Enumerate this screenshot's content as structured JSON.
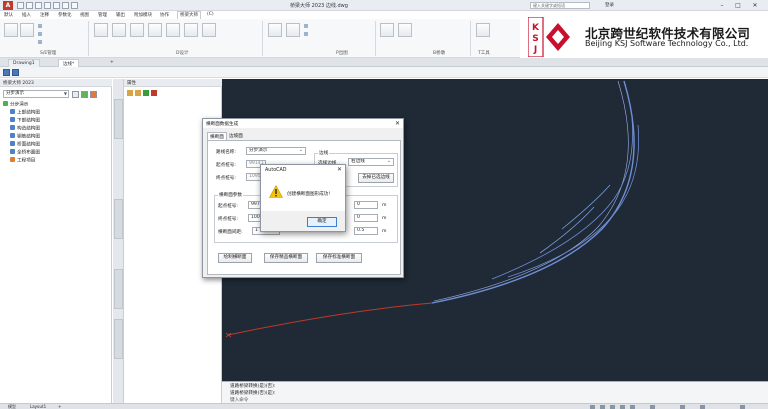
{
  "titlebar": {
    "app_icon": "A",
    "title": "桥梁大师 2023   边线.dwg",
    "search_placeholder": "键入关键字或短语",
    "login": "登录",
    "window_controls": [
      "–",
      "□",
      "✕"
    ]
  },
  "ribbon": {
    "tabs": [
      "默认",
      "插入",
      "注释",
      "参数化",
      "视图",
      "管理",
      "输出",
      "附加模块",
      "协作",
      "桥梁大师",
      "(C)"
    ],
    "active_tab": "桥梁大师",
    "groups": [
      "S/E管理",
      "D设计",
      "P出图",
      "B桥墩",
      "T工具",
      "H帮助"
    ]
  },
  "logo": {
    "cn": "北京跨世纪软件技术有限公司",
    "en": "Beijing KSJ Software Technology Co., Ltd.",
    "mark_text": "KSJ",
    "brand_color": "#c8102e"
  },
  "filetabs": [
    "Drawing1",
    "边线*",
    "+"
  ],
  "left_panel": {
    "title": "桥梁大师 2023",
    "combo_value": "分步演示",
    "tree": [
      {
        "label": "分步演示",
        "level": 0,
        "icon": "project-icon"
      },
      {
        "label": "上部结构图",
        "level": 1,
        "icon": "folder-icon"
      },
      {
        "label": "下部结构图",
        "level": 1,
        "icon": "folder-icon"
      },
      {
        "label": "构造结构图",
        "level": 1,
        "icon": "folder-icon"
      },
      {
        "label": "钢筋结构图",
        "level": 1,
        "icon": "folder-icon"
      },
      {
        "label": "桥面结构图",
        "level": 1,
        "icon": "folder-icon"
      },
      {
        "label": "全桥布置图",
        "level": 1,
        "icon": "folder-icon"
      },
      {
        "label": "工程项目",
        "level": 1,
        "icon": "folder-icon"
      }
    ]
  },
  "prop_panel": {
    "title": "属性"
  },
  "command_line": {
    "lines": [
      "道路桥梁转换(是)(否):",
      "道路桥梁转换(否)(是):"
    ],
    "input_placeholder": "键入命令"
  },
  "statusbar": {
    "tabs": [
      "模型",
      "Layout1",
      "+"
    ]
  },
  "dialog": {
    "title": "横断面数据生成",
    "tabs": [
      "横断面",
      "边坡面"
    ],
    "active_tab": "横断面",
    "road_name_label": "路线名称:",
    "road_name_value": "分步演示",
    "start_label": "起点桩号:",
    "start_value": "99141",
    "end_label": "终点桩号:",
    "end_value": "1095",
    "edge_group": "边线",
    "edge_sub_label": "选择边线",
    "edge_combo": "右边线",
    "edge_button": "去掉已选边线",
    "section_group": "横断面参数",
    "sec_start_label": "起点桩号:",
    "sec_start_value": "99731",
    "sec_end_label": "终点桩号:",
    "sec_end_value": "100563",
    "sec_step_label": "横断面间距:",
    "sec_step_value": "1",
    "right_val_1": "0",
    "right_val_2": "0",
    "right_val_3": "0.5",
    "unit": "m",
    "buttons": [
      "绘制横断面",
      "保存精品横断面",
      "保存标准横断面"
    ]
  },
  "msgbox": {
    "title": "AutoCAD",
    "message": "创建横断面图形成功!",
    "ok_label": "确定",
    "warning_color": "#f5c211"
  }
}
